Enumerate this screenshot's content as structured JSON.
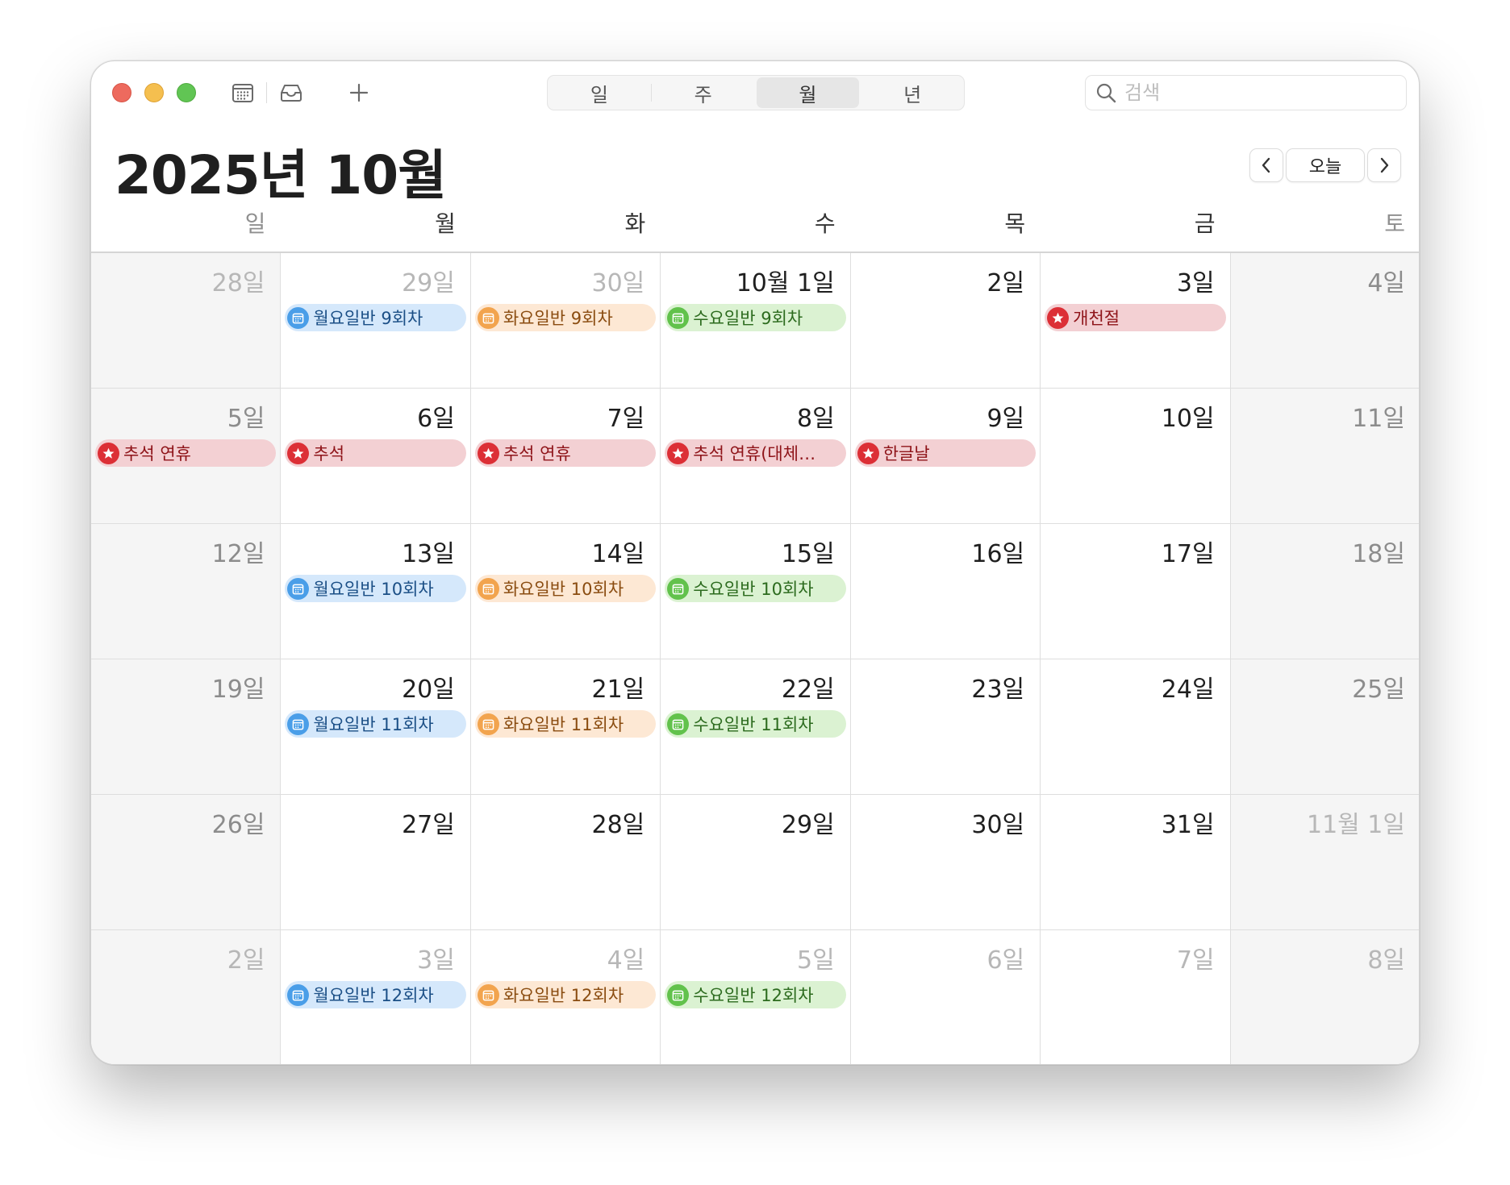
{
  "toolbar": {
    "view_tabs": [
      {
        "label": "일",
        "active": false
      },
      {
        "label": "주",
        "active": false
      },
      {
        "label": "월",
        "active": true
      },
      {
        "label": "년",
        "active": false
      }
    ],
    "search_placeholder": "검색",
    "today_label": "오늘",
    "icons": [
      "calendar-list-icon",
      "inbox-icon",
      "plus-icon",
      "search-icon",
      "chevron-left-icon",
      "chevron-right-icon"
    ]
  },
  "month_title": "2025년 10월",
  "weekdays": [
    "일",
    "월",
    "화",
    "수",
    "목",
    "금",
    "토"
  ],
  "colors": {
    "blue": "#4a9ee8",
    "orange": "#f2a44e",
    "green": "#62c24c",
    "red": "#dc2f36"
  },
  "weeks": [
    [
      {
        "label": "28일",
        "other_month": true
      },
      {
        "label": "29일",
        "other_month": true,
        "events": [
          {
            "title": "월요일반 9회차",
            "color": "blue",
            "type": "calendar"
          }
        ]
      },
      {
        "label": "30일",
        "other_month": true,
        "events": [
          {
            "title": "화요일반 9회차",
            "color": "orange",
            "type": "calendar"
          }
        ]
      },
      {
        "label": "10월 1일",
        "events": [
          {
            "title": "수요일반 9회차",
            "color": "green",
            "type": "calendar"
          }
        ]
      },
      {
        "label": "2일"
      },
      {
        "label": "3일",
        "events": [
          {
            "title": "개천절",
            "color": "red",
            "type": "holiday"
          }
        ]
      },
      {
        "label": "4일"
      }
    ],
    [
      {
        "label": "5일",
        "events": [
          {
            "title": "추석 연휴",
            "color": "red",
            "type": "holiday"
          }
        ]
      },
      {
        "label": "6일",
        "events": [
          {
            "title": "추석",
            "color": "red",
            "type": "holiday"
          }
        ]
      },
      {
        "label": "7일",
        "events": [
          {
            "title": "추석 연휴",
            "color": "red",
            "type": "holiday"
          }
        ]
      },
      {
        "label": "8일",
        "events": [
          {
            "title": "추석 연휴(대체…",
            "color": "red",
            "type": "holiday"
          }
        ]
      },
      {
        "label": "9일",
        "events": [
          {
            "title": "한글날",
            "color": "red",
            "type": "holiday"
          }
        ]
      },
      {
        "label": "10일"
      },
      {
        "label": "11일"
      }
    ],
    [
      {
        "label": "12일"
      },
      {
        "label": "13일",
        "events": [
          {
            "title": "월요일반 10회차",
            "color": "blue",
            "type": "calendar"
          }
        ]
      },
      {
        "label": "14일",
        "events": [
          {
            "title": "화요일반 10회차",
            "color": "orange",
            "type": "calendar"
          }
        ]
      },
      {
        "label": "15일",
        "events": [
          {
            "title": "수요일반 10회차",
            "color": "green",
            "type": "calendar"
          }
        ]
      },
      {
        "label": "16일"
      },
      {
        "label": "17일"
      },
      {
        "label": "18일"
      }
    ],
    [
      {
        "label": "19일"
      },
      {
        "label": "20일",
        "events": [
          {
            "title": "월요일반 11회차",
            "color": "blue",
            "type": "calendar"
          }
        ]
      },
      {
        "label": "21일",
        "events": [
          {
            "title": "화요일반 11회차",
            "color": "orange",
            "type": "calendar"
          }
        ]
      },
      {
        "label": "22일",
        "events": [
          {
            "title": "수요일반 11회차",
            "color": "green",
            "type": "calendar"
          }
        ]
      },
      {
        "label": "23일"
      },
      {
        "label": "24일"
      },
      {
        "label": "25일"
      }
    ],
    [
      {
        "label": "26일"
      },
      {
        "label": "27일"
      },
      {
        "label": "28일"
      },
      {
        "label": "29일"
      },
      {
        "label": "30일"
      },
      {
        "label": "31일"
      },
      {
        "label": "11월 1일",
        "other_month": true
      }
    ],
    [
      {
        "label": "2일",
        "other_month": true
      },
      {
        "label": "3일",
        "other_month": true,
        "events": [
          {
            "title": "월요일반 12회차",
            "color": "blue",
            "type": "calendar"
          }
        ]
      },
      {
        "label": "4일",
        "other_month": true,
        "events": [
          {
            "title": "화요일반 12회차",
            "color": "orange",
            "type": "calendar"
          }
        ]
      },
      {
        "label": "5일",
        "other_month": true,
        "events": [
          {
            "title": "수요일반 12회차",
            "color": "green",
            "type": "calendar"
          }
        ]
      },
      {
        "label": "6일",
        "other_month": true
      },
      {
        "label": "7일",
        "other_month": true
      },
      {
        "label": "8일",
        "other_month": true
      }
    ]
  ]
}
